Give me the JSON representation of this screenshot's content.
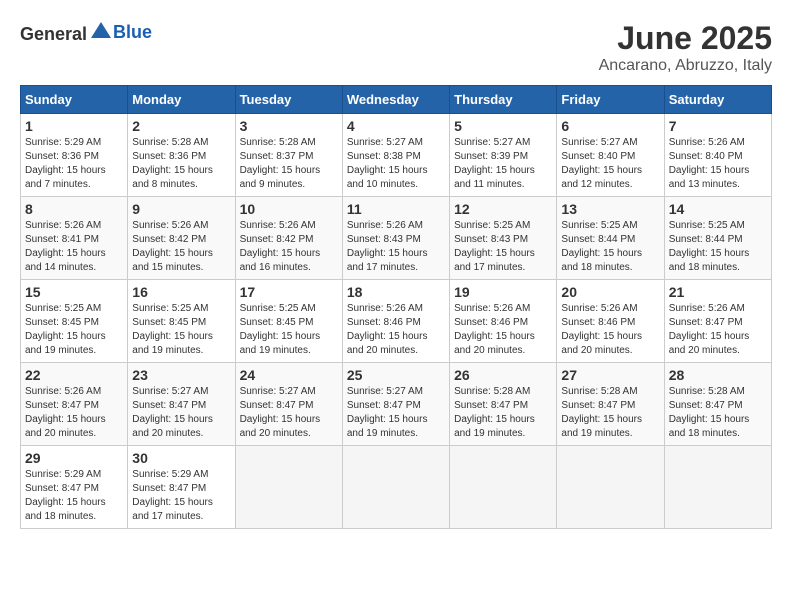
{
  "header": {
    "logo_general": "General",
    "logo_blue": "Blue",
    "month": "June 2025",
    "location": "Ancarano, Abruzzo, Italy"
  },
  "weekdays": [
    "Sunday",
    "Monday",
    "Tuesday",
    "Wednesday",
    "Thursday",
    "Friday",
    "Saturday"
  ],
  "weeks": [
    [
      {
        "day": "1",
        "sunrise": "Sunrise: 5:29 AM",
        "sunset": "Sunset: 8:36 PM",
        "daylight": "Daylight: 15 hours and 7 minutes."
      },
      {
        "day": "2",
        "sunrise": "Sunrise: 5:28 AM",
        "sunset": "Sunset: 8:36 PM",
        "daylight": "Daylight: 15 hours and 8 minutes."
      },
      {
        "day": "3",
        "sunrise": "Sunrise: 5:28 AM",
        "sunset": "Sunset: 8:37 PM",
        "daylight": "Daylight: 15 hours and 9 minutes."
      },
      {
        "day": "4",
        "sunrise": "Sunrise: 5:27 AM",
        "sunset": "Sunset: 8:38 PM",
        "daylight": "Daylight: 15 hours and 10 minutes."
      },
      {
        "day": "5",
        "sunrise": "Sunrise: 5:27 AM",
        "sunset": "Sunset: 8:39 PM",
        "daylight": "Daylight: 15 hours and 11 minutes."
      },
      {
        "day": "6",
        "sunrise": "Sunrise: 5:27 AM",
        "sunset": "Sunset: 8:40 PM",
        "daylight": "Daylight: 15 hours and 12 minutes."
      },
      {
        "day": "7",
        "sunrise": "Sunrise: 5:26 AM",
        "sunset": "Sunset: 8:40 PM",
        "daylight": "Daylight: 15 hours and 13 minutes."
      }
    ],
    [
      {
        "day": "8",
        "sunrise": "Sunrise: 5:26 AM",
        "sunset": "Sunset: 8:41 PM",
        "daylight": "Daylight: 15 hours and 14 minutes."
      },
      {
        "day": "9",
        "sunrise": "Sunrise: 5:26 AM",
        "sunset": "Sunset: 8:42 PM",
        "daylight": "Daylight: 15 hours and 15 minutes."
      },
      {
        "day": "10",
        "sunrise": "Sunrise: 5:26 AM",
        "sunset": "Sunset: 8:42 PM",
        "daylight": "Daylight: 15 hours and 16 minutes."
      },
      {
        "day": "11",
        "sunrise": "Sunrise: 5:26 AM",
        "sunset": "Sunset: 8:43 PM",
        "daylight": "Daylight: 15 hours and 17 minutes."
      },
      {
        "day": "12",
        "sunrise": "Sunrise: 5:25 AM",
        "sunset": "Sunset: 8:43 PM",
        "daylight": "Daylight: 15 hours and 17 minutes."
      },
      {
        "day": "13",
        "sunrise": "Sunrise: 5:25 AM",
        "sunset": "Sunset: 8:44 PM",
        "daylight": "Daylight: 15 hours and 18 minutes."
      },
      {
        "day": "14",
        "sunrise": "Sunrise: 5:25 AM",
        "sunset": "Sunset: 8:44 PM",
        "daylight": "Daylight: 15 hours and 18 minutes."
      }
    ],
    [
      {
        "day": "15",
        "sunrise": "Sunrise: 5:25 AM",
        "sunset": "Sunset: 8:45 PM",
        "daylight": "Daylight: 15 hours and 19 minutes."
      },
      {
        "day": "16",
        "sunrise": "Sunrise: 5:25 AM",
        "sunset": "Sunset: 8:45 PM",
        "daylight": "Daylight: 15 hours and 19 minutes."
      },
      {
        "day": "17",
        "sunrise": "Sunrise: 5:25 AM",
        "sunset": "Sunset: 8:45 PM",
        "daylight": "Daylight: 15 hours and 19 minutes."
      },
      {
        "day": "18",
        "sunrise": "Sunrise: 5:26 AM",
        "sunset": "Sunset: 8:46 PM",
        "daylight": "Daylight: 15 hours and 20 minutes."
      },
      {
        "day": "19",
        "sunrise": "Sunrise: 5:26 AM",
        "sunset": "Sunset: 8:46 PM",
        "daylight": "Daylight: 15 hours and 20 minutes."
      },
      {
        "day": "20",
        "sunrise": "Sunrise: 5:26 AM",
        "sunset": "Sunset: 8:46 PM",
        "daylight": "Daylight: 15 hours and 20 minutes."
      },
      {
        "day": "21",
        "sunrise": "Sunrise: 5:26 AM",
        "sunset": "Sunset: 8:47 PM",
        "daylight": "Daylight: 15 hours and 20 minutes."
      }
    ],
    [
      {
        "day": "22",
        "sunrise": "Sunrise: 5:26 AM",
        "sunset": "Sunset: 8:47 PM",
        "daylight": "Daylight: 15 hours and 20 minutes."
      },
      {
        "day": "23",
        "sunrise": "Sunrise: 5:27 AM",
        "sunset": "Sunset: 8:47 PM",
        "daylight": "Daylight: 15 hours and 20 minutes."
      },
      {
        "day": "24",
        "sunrise": "Sunrise: 5:27 AM",
        "sunset": "Sunset: 8:47 PM",
        "daylight": "Daylight: 15 hours and 20 minutes."
      },
      {
        "day": "25",
        "sunrise": "Sunrise: 5:27 AM",
        "sunset": "Sunset: 8:47 PM",
        "daylight": "Daylight: 15 hours and 19 minutes."
      },
      {
        "day": "26",
        "sunrise": "Sunrise: 5:28 AM",
        "sunset": "Sunset: 8:47 PM",
        "daylight": "Daylight: 15 hours and 19 minutes."
      },
      {
        "day": "27",
        "sunrise": "Sunrise: 5:28 AM",
        "sunset": "Sunset: 8:47 PM",
        "daylight": "Daylight: 15 hours and 19 minutes."
      },
      {
        "day": "28",
        "sunrise": "Sunrise: 5:28 AM",
        "sunset": "Sunset: 8:47 PM",
        "daylight": "Daylight: 15 hours and 18 minutes."
      }
    ],
    [
      {
        "day": "29",
        "sunrise": "Sunrise: 5:29 AM",
        "sunset": "Sunset: 8:47 PM",
        "daylight": "Daylight: 15 hours and 18 minutes."
      },
      {
        "day": "30",
        "sunrise": "Sunrise: 5:29 AM",
        "sunset": "Sunset: 8:47 PM",
        "daylight": "Daylight: 15 hours and 17 minutes."
      },
      null,
      null,
      null,
      null,
      null
    ]
  ]
}
